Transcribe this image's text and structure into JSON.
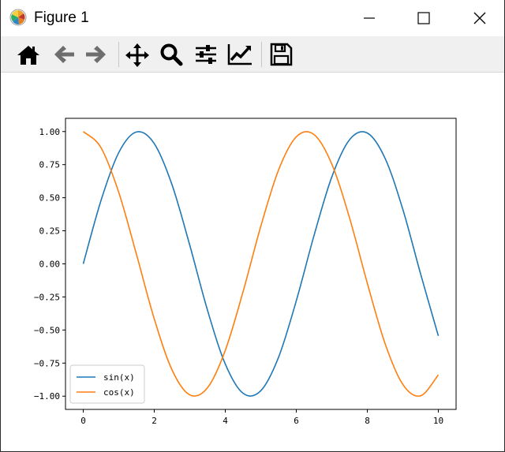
{
  "window": {
    "title": "Figure 1",
    "controls": {
      "minimize": "minimize",
      "maximize": "maximize",
      "close": "close"
    }
  },
  "toolbar": {
    "items": [
      {
        "name": "home-icon",
        "tooltip": "Reset original view"
      },
      {
        "name": "back-arrow-icon",
        "tooltip": "Back to previous view"
      },
      {
        "name": "forward-arrow-icon",
        "tooltip": "Forward to next view"
      },
      {
        "name": "pan-icon",
        "tooltip": "Pan axes"
      },
      {
        "name": "zoom-icon",
        "tooltip": "Zoom to rectangle"
      },
      {
        "name": "subplots-icon",
        "tooltip": "Configure subplots"
      },
      {
        "name": "edit-axis-icon",
        "tooltip": "Edit axis, curve and image parameters"
      },
      {
        "name": "save-icon",
        "tooltip": "Save the figure"
      }
    ]
  },
  "colors": {
    "sin": "#1f77b4",
    "cos": "#ff7f0e",
    "icon": "#000000",
    "disabled_icon": "#6e6e6e"
  },
  "chart_data": {
    "type": "line",
    "title": "",
    "xlabel": "",
    "ylabel": "",
    "xlim": [
      -0.5,
      10.5
    ],
    "ylim": [
      -1.1,
      1.1
    ],
    "x_ticks": [
      0,
      2,
      4,
      6,
      8,
      10
    ],
    "x_tick_labels": [
      "0",
      "2",
      "4",
      "6",
      "8",
      "10"
    ],
    "y_ticks": [
      1.0,
      0.75,
      0.5,
      0.25,
      0.0,
      -0.25,
      -0.5,
      -0.75,
      -1.0
    ],
    "y_tick_labels": [
      "1.00",
      "0.75",
      "0.50",
      "0.25",
      "0.00",
      "−0.25",
      "−0.50",
      "−0.75",
      "−1.00"
    ],
    "grid": false,
    "legend": {
      "placement": "lower-left",
      "entries": [
        "sin(x)",
        "cos(x)"
      ]
    },
    "x": [
      0,
      0.5,
      1.0,
      1.5,
      2.0,
      2.5,
      3.0,
      3.5,
      4.0,
      4.5,
      5.0,
      5.5,
      6.0,
      6.5,
      7.0,
      7.5,
      8.0,
      8.5,
      9.0,
      9.5,
      10.0
    ],
    "series": [
      {
        "name": "sin(x)",
        "color": "#1f77b4",
        "values": [
          0.0,
          0.479,
          0.841,
          0.997,
          0.909,
          0.598,
          0.141,
          -0.351,
          -0.757,
          -0.978,
          -0.959,
          -0.706,
          -0.279,
          0.215,
          0.657,
          0.938,
          0.989,
          0.798,
          0.412,
          -0.075,
          -0.544
        ]
      },
      {
        "name": "cos(x)",
        "color": "#ff7f0e",
        "values": [
          1.0,
          0.878,
          0.54,
          0.071,
          -0.416,
          -0.801,
          -0.99,
          -0.936,
          -0.654,
          -0.211,
          0.284,
          0.709,
          0.96,
          0.977,
          0.754,
          0.347,
          -0.146,
          -0.602,
          -0.911,
          -0.997,
          -0.839
        ]
      }
    ]
  }
}
